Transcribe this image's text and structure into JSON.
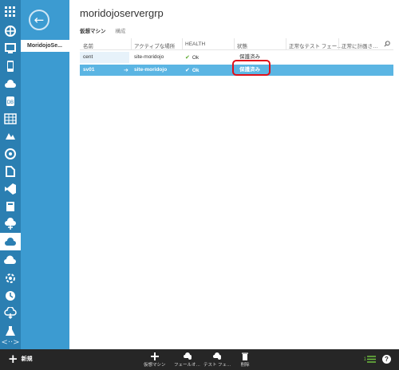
{
  "nav": {
    "rail_icons": [
      "all-items-icon",
      "websites-icon",
      "virtual-machines-icon",
      "mobile-services-icon",
      "cloud-services-icon",
      "sql-databases-icon",
      "storage-icon",
      "hdinsight-icon",
      "media-services-icon",
      "service-bus-icon",
      "visual-studio-icon",
      "cache-icon",
      "biztalk-icon",
      "recovery-services-icon",
      "networks-icon",
      "traffic-manager-icon",
      "automation-icon",
      "active-directory-icon",
      "marketplace-icon",
      "store-icon",
      "settings-icon"
    ],
    "rail_footer": "<··>",
    "back": "←",
    "selected_item": "MoridojoSe..."
  },
  "page": {
    "title": "moridojoservergrp",
    "tabs": [
      "仮想マシン",
      "構成"
    ]
  },
  "grid": {
    "columns": [
      "名前",
      "アクティブな場所",
      "HEALTH",
      "状態",
      "正常なテスト フェー…",
      "正常に計画さ…"
    ],
    "rows": [
      {
        "name": "cent",
        "location": "site-moridojo",
        "health": "Ok",
        "status": "保護済み",
        "test": "",
        "planned": ""
      },
      {
        "name": "sv01",
        "location": "site-moridojo",
        "health": "Ok",
        "status": "保護済み",
        "test": "",
        "planned": ""
      }
    ],
    "arrow": "➔",
    "check": "✔"
  },
  "bottom": {
    "new_label": "新規",
    "commands": [
      "仮想マシン",
      "フェールオ…",
      "テスト フェ…",
      "削除"
    ],
    "help": "?",
    "count": "1"
  },
  "colors": {
    "rail": "#2b7fb2",
    "nav2": "#3c9bd1",
    "selected_row": "#5bb5e3",
    "highlight": "#e0101a",
    "bottom_bar": "#262626"
  }
}
